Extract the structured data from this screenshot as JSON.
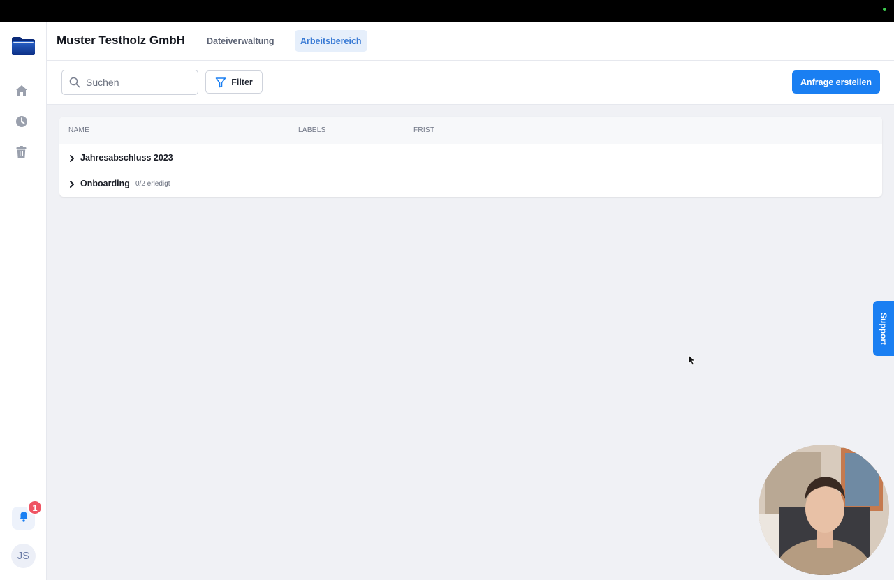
{
  "sidebar": {
    "nav": [
      {
        "icon": "home-icon"
      },
      {
        "icon": "clock-icon"
      },
      {
        "icon": "trash-icon"
      }
    ],
    "notifications": {
      "icon": "bell-icon",
      "count": "1"
    },
    "user": {
      "initials": "JS"
    }
  },
  "header": {
    "company": "Muster Testholz GmbH",
    "tabs": [
      {
        "label": "Dateiverwaltung",
        "active": false
      },
      {
        "label": "Arbeitsbereich",
        "active": true
      }
    ]
  },
  "toolbar": {
    "search_placeholder": "Suchen",
    "filter_label": "Filter",
    "create_label": "Anfrage erstellen"
  },
  "table": {
    "columns": [
      "NAME",
      "LABELS",
      "FRIST"
    ],
    "rows": [
      {
        "name": "Jahresabschluss 2023",
        "meta": ""
      },
      {
        "name": "Onboarding",
        "meta": "0/2 erledigt"
      }
    ]
  },
  "support_label": "Support",
  "colors": {
    "accent": "#1a7ff2",
    "badge": "#ef5464",
    "background": "#f0f1f5"
  }
}
